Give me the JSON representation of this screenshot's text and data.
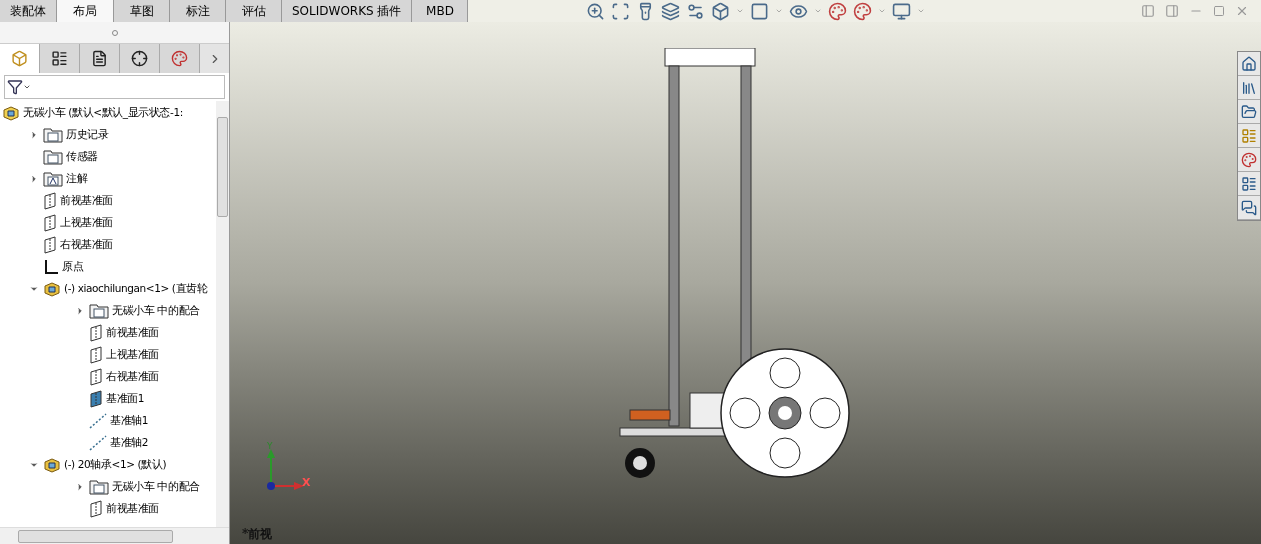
{
  "tabs": [
    {
      "label": "装配体",
      "selected": false
    },
    {
      "label": "布局",
      "selected": true
    },
    {
      "label": "草图",
      "selected": false
    },
    {
      "label": "标注",
      "selected": false
    },
    {
      "label": "评估",
      "selected": false
    },
    {
      "label": "SOLIDWORKS 插件",
      "selected": false
    },
    {
      "label": "MBD",
      "selected": false
    }
  ],
  "panel_tabs": [
    {
      "kind": "feature",
      "selected": true
    },
    {
      "kind": "property",
      "selected": false
    },
    {
      "kind": "config",
      "selected": false
    },
    {
      "kind": "dimxpert",
      "selected": false
    },
    {
      "kind": "display",
      "selected": false
    }
  ],
  "tree": [
    {
      "label": "无碳小车  (默认<默认_显示状态-1:",
      "kind": "assembly",
      "children": [
        {
          "label": "历史记录",
          "kind": "history",
          "expanded": false
        },
        {
          "label": "传感器",
          "kind": "sensor"
        },
        {
          "label": "注解",
          "kind": "annotation",
          "expanded": false
        },
        {
          "label": "前视基准面",
          "kind": "plane"
        },
        {
          "label": "上视基准面",
          "kind": "plane"
        },
        {
          "label": "右视基准面",
          "kind": "plane"
        },
        {
          "label": "原点",
          "kind": "origin"
        },
        {
          "label": "(-) xiaochilungan<1> (直齿轮",
          "kind": "part",
          "expanded": true,
          "children": [
            {
              "label": "无碳小车 中的配合",
              "kind": "mates",
              "expanded": false
            },
            {
              "label": "前视基准面",
              "kind": "plane"
            },
            {
              "label": "上视基准面",
              "kind": "plane"
            },
            {
              "label": "右视基准面",
              "kind": "plane"
            },
            {
              "label": "基准面1",
              "kind": "plane-solid"
            },
            {
              "label": "基准轴1",
              "kind": "axis"
            },
            {
              "label": "基准轴2",
              "kind": "axis"
            }
          ]
        },
        {
          "label": "(-) 20轴承<1> (默认)",
          "kind": "part",
          "expanded": true,
          "children": [
            {
              "label": "无碳小车 中的配合",
              "kind": "mates",
              "expanded": false
            },
            {
              "label": "前视基准面",
              "kind": "plane"
            }
          ]
        }
      ]
    }
  ],
  "triad": {
    "x_label": "X",
    "y_label": "Y"
  },
  "view_label": "*前视"
}
